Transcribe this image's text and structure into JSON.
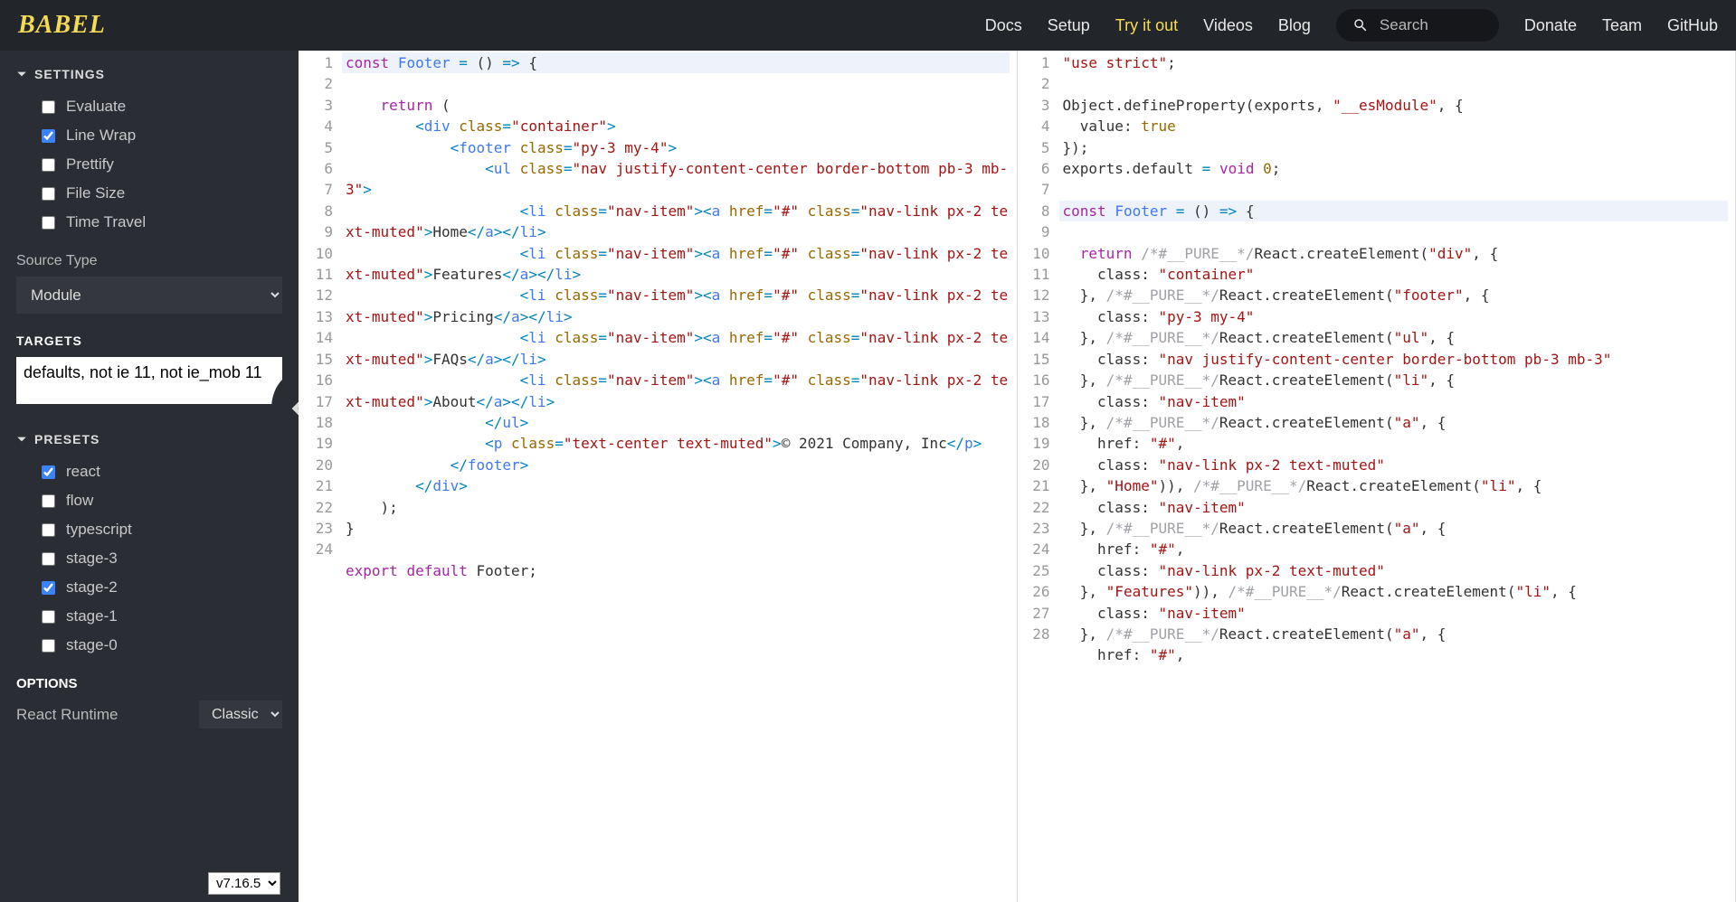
{
  "header": {
    "logo": "BABEL",
    "nav": [
      "Docs",
      "Setup",
      "Try it out",
      "Videos",
      "Blog"
    ],
    "nav_active_index": 2,
    "search_placeholder": "Search",
    "nav_right": [
      "Donate",
      "Team",
      "GitHub"
    ]
  },
  "sidebar": {
    "settings": {
      "title": "SETTINGS",
      "items": [
        {
          "label": "Evaluate",
          "checked": false
        },
        {
          "label": "Line Wrap",
          "checked": true
        },
        {
          "label": "Prettify",
          "checked": false
        },
        {
          "label": "File Size",
          "checked": false
        },
        {
          "label": "Time Travel",
          "checked": false
        }
      ]
    },
    "source_type_label": "Source Type",
    "source_type_value": "Module",
    "targets_label": "TARGETS",
    "targets_value": "defaults, not ie 11, not ie_mob 11",
    "presets": {
      "title": "PRESETS",
      "items": [
        {
          "label": "react",
          "checked": true
        },
        {
          "label": "flow",
          "checked": false
        },
        {
          "label": "typescript",
          "checked": false
        },
        {
          "label": "stage-3",
          "checked": false
        },
        {
          "label": "stage-2",
          "checked": true
        },
        {
          "label": "stage-1",
          "checked": false
        },
        {
          "label": "stage-0",
          "checked": false
        }
      ]
    },
    "options_label": "OPTIONS",
    "react_runtime_label": "React Runtime",
    "react_runtime_value": "Classic",
    "version": "v7.16.5"
  },
  "editor_left": {
    "lines": [
      1,
      2,
      3,
      4,
      5,
      6,
      7,
      8,
      9,
      10,
      11,
      12,
      13,
      14,
      15,
      16,
      17,
      18,
      19,
      20,
      21,
      22,
      23,
      24
    ]
  },
  "editor_right": {
    "lines": [
      1,
      2,
      3,
      4,
      5,
      6,
      7,
      8,
      9,
      10,
      11,
      12,
      13,
      14,
      15,
      16,
      17,
      18,
      19,
      20,
      21,
      22,
      23,
      24,
      25,
      26,
      27,
      28
    ]
  },
  "source_code": "const Footer = () => {\n    return (\n        <div class=\"container\">\n            <footer class=\"py-3 my-4\">\n                <ul class=\"nav justify-content-center border-bottom pb-3 mb-3\">\n                    <li class=\"nav-item\"><a href=\"#\" class=\"nav-link px-2 text-muted\">Home</a></li>\n                    <li class=\"nav-item\"><a href=\"#\" class=\"nav-link px-2 text-muted\">Features</a></li>\n                    <li class=\"nav-item\"><a href=\"#\" class=\"nav-link px-2 text-muted\">Pricing</a></li>\n                    <li class=\"nav-item\"><a href=\"#\" class=\"nav-link px-2 text-muted\">FAQs</a></li>\n                    <li class=\"nav-item\"><a href=\"#\" class=\"nav-link px-2 text-muted\">About</a></li>\n                </ul>\n                <p class=\"text-center text-muted\">© 2021 Company, Inc</p>\n            </footer>\n        </div>\n    );\n}\n\nexport default Footer;",
  "output_code": "\"use strict\";\n\nObject.defineProperty(exports, \"__esModule\", {\n  value: true\n});\nexports.default = void 0;\n\nconst Footer = () => {\n  return /*#__PURE__*/React.createElement(\"div\", {\n    class: \"container\"\n  }, /*#__PURE__*/React.createElement(\"footer\", {\n    class: \"py-3 my-4\"\n  }, /*#__PURE__*/React.createElement(\"ul\", {\n    class: \"nav justify-content-center border-bottom pb-3 mb-3\"\n  }, /*#__PURE__*/React.createElement(\"li\", {\n    class: \"nav-item\"\n  }, /*#__PURE__*/React.createElement(\"a\", {\n    href: \"#\",\n    class: \"nav-link px-2 text-muted\"\n  }, \"Home\")), /*#__PURE__*/React.createElement(\"li\", {\n    class: \"nav-item\"\n  }, /*#__PURE__*/React.createElement(\"a\", {\n    href: \"#\",\n    class: \"nav-link px-2 text-muted\"\n  }, \"Features\")), /*#__PURE__*/React.createElement(\"li\", {\n    class: \"nav-item\"\n  }, /*#__PURE__*/React.createElement(\"a\", {\n    href: \"#\","
}
